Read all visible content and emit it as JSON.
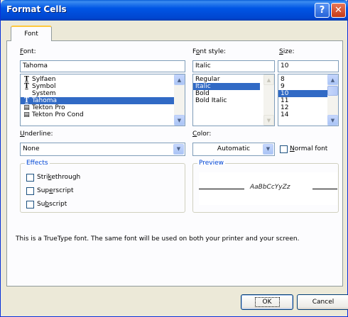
{
  "window": {
    "title": "Format Cells"
  },
  "titlebar": {
    "help_label": "?",
    "close_label": "✕"
  },
  "tabs": [
    {
      "label": "Font"
    }
  ],
  "font": {
    "label_pre": "",
    "label_u": "F",
    "label_post": "ont:",
    "value": "Tahoma",
    "list": [
      {
        "label": "Sylfaen",
        "icon": "truetype-icon",
        "glyph": "T̲",
        "selected": false
      },
      {
        "label": "Symbol",
        "icon": "truetype-icon",
        "glyph": "T̲",
        "selected": false
      },
      {
        "label": "System",
        "icon": "",
        "glyph": "",
        "selected": false
      },
      {
        "label": "Tahoma",
        "icon": "truetype-icon",
        "glyph": "T̲",
        "selected": true
      },
      {
        "label": "Tekton Pro",
        "icon": "printer-font-icon",
        "glyph": "▤",
        "selected": false
      },
      {
        "label": "Tekton Pro Cond",
        "icon": "printer-font-icon",
        "glyph": "▤",
        "selected": false
      }
    ]
  },
  "font_style": {
    "label_pre": "F",
    "label_u": "o",
    "label_post": "nt style:",
    "value": "Italic",
    "list": [
      {
        "label": "Regular",
        "selected": false
      },
      {
        "label": "Italic",
        "selected": true
      },
      {
        "label": "Bold",
        "selected": false
      },
      {
        "label": "Bold Italic",
        "selected": false
      }
    ]
  },
  "size": {
    "label_pre": "",
    "label_u": "S",
    "label_post": "ize:",
    "value": "10",
    "list": [
      {
        "label": "8",
        "selected": false
      },
      {
        "label": "9",
        "selected": false
      },
      {
        "label": "10",
        "selected": true
      },
      {
        "label": "11",
        "selected": false
      },
      {
        "label": "12",
        "selected": false
      },
      {
        "label": "14",
        "selected": false
      }
    ]
  },
  "underline": {
    "label_pre": "",
    "label_u": "U",
    "label_post": "nderline:",
    "value": "None"
  },
  "color": {
    "label_pre": "",
    "label_u": "C",
    "label_post": "olor:",
    "value": "Automatic"
  },
  "normal_font": {
    "label_pre": "",
    "label_u": "N",
    "label_post": "ormal font"
  },
  "effects": {
    "title": "Effects",
    "items": [
      {
        "pre": "Stri",
        "u": "k",
        "post": "ethrough"
      },
      {
        "pre": "Sup",
        "u": "e",
        "post": "rscript"
      },
      {
        "pre": "Su",
        "u": "b",
        "post": "script"
      }
    ]
  },
  "preview": {
    "title": "Preview",
    "sample": "AaBbCcYyZz"
  },
  "info_text": "This is a TrueType font.  The same font will be used on both your printer and your screen.",
  "buttons": {
    "ok": "OK",
    "cancel": "Cancel"
  },
  "colors": {
    "titlebar": "#0054e3",
    "accent": "#316ac5",
    "group_title": "#0046d5"
  }
}
